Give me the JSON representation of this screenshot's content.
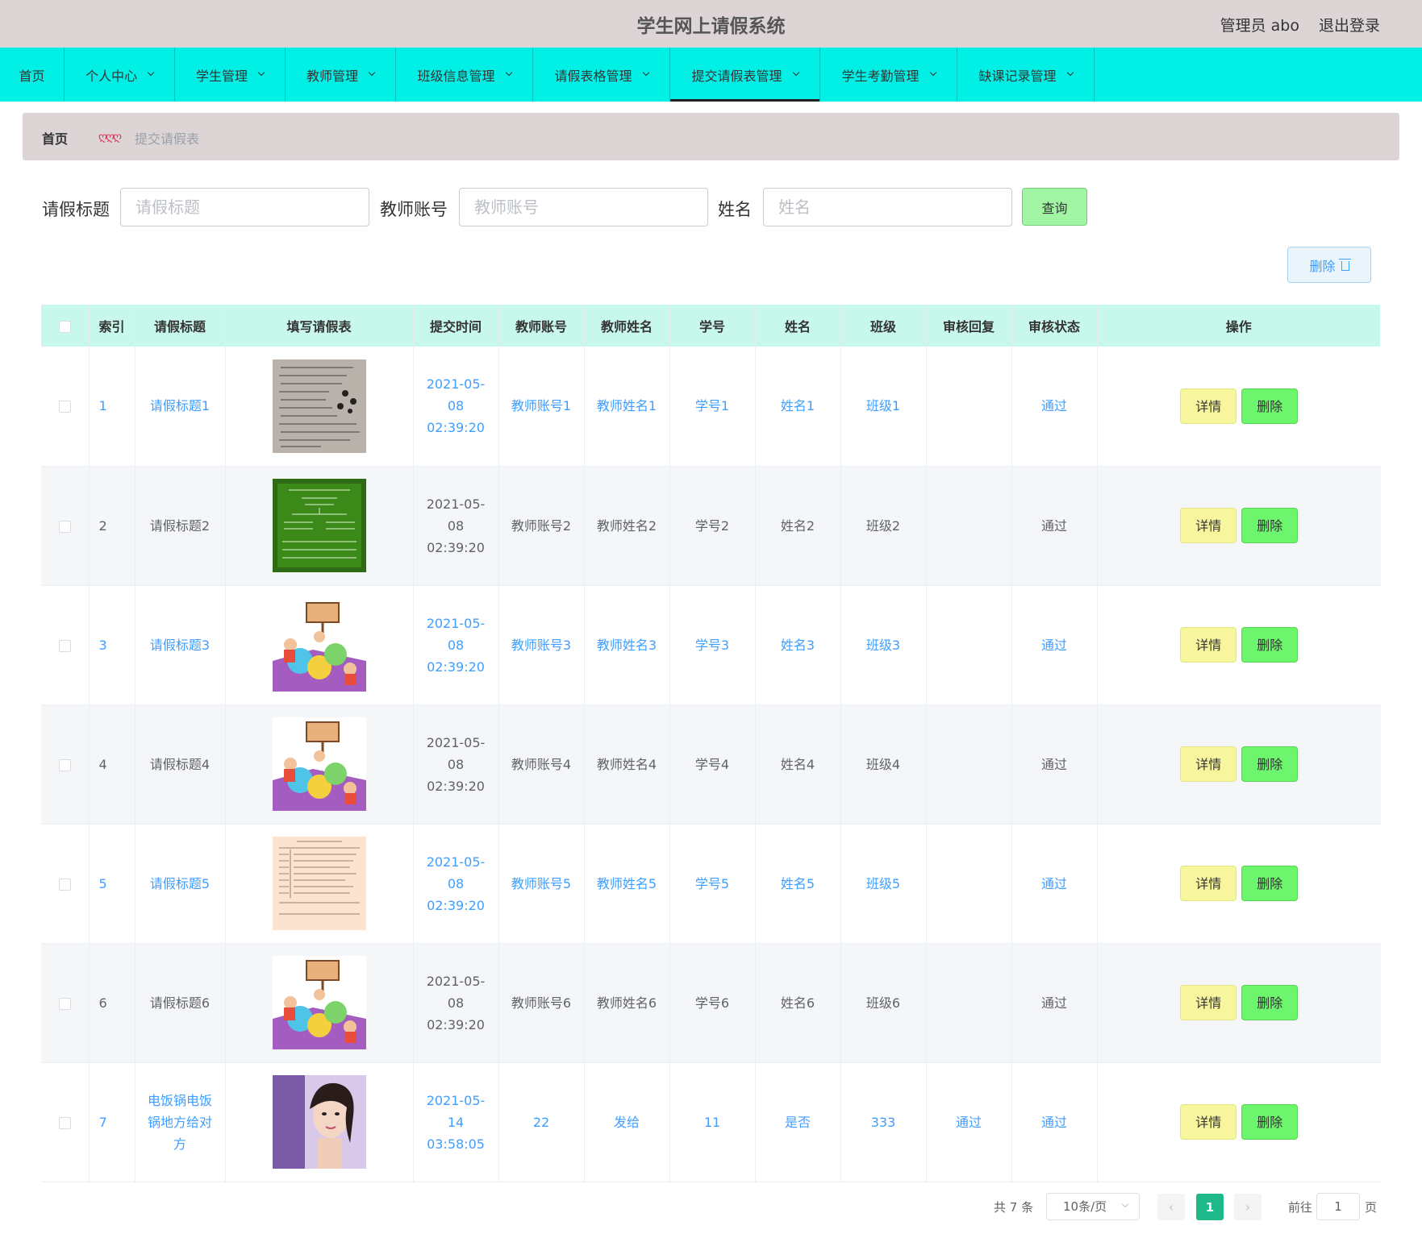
{
  "header": {
    "title": "学生网上请假系统",
    "user": "管理员 abo",
    "logout": "退出登录"
  },
  "nav": [
    {
      "label": "首页",
      "dropdown": false,
      "active": false
    },
    {
      "label": "个人中心",
      "dropdown": true,
      "active": false
    },
    {
      "label": "学生管理",
      "dropdown": true,
      "active": false
    },
    {
      "label": "教师管理",
      "dropdown": true,
      "active": false
    },
    {
      "label": "班级信息管理",
      "dropdown": true,
      "active": false
    },
    {
      "label": "请假表格管理",
      "dropdown": true,
      "active": false
    },
    {
      "label": "提交请假表管理",
      "dropdown": true,
      "active": true
    },
    {
      "label": "学生考勤管理",
      "dropdown": true,
      "active": false
    },
    {
      "label": "缺课记录管理",
      "dropdown": true,
      "active": false
    }
  ],
  "breadcrumb": {
    "home": "首页",
    "separator": "ღღღ",
    "current": "提交请假表"
  },
  "search": {
    "title_label": "请假标题",
    "title_placeholder": "请假标题",
    "teacher_label": "教师账号",
    "teacher_placeholder": "教师账号",
    "name_label": "姓名",
    "name_placeholder": "姓名",
    "query_button": "查询"
  },
  "bulk_delete_button": "删除",
  "table": {
    "columns": [
      "索引",
      "请假标题",
      "填写请假表",
      "提交时间",
      "教师账号",
      "教师姓名",
      "学号",
      "姓名",
      "班级",
      "审核回复",
      "审核状态",
      "操作"
    ],
    "detail_label": "详情",
    "delete_label": "删除",
    "rows": [
      {
        "index": "1",
        "title": "请假标题1",
        "image": "worksheet-scan",
        "time": "2021-05-08 02:39:20",
        "teacher_account": "教师账号1",
        "teacher_name": "教师姓名1",
        "student_id": "学号1",
        "name": "姓名1",
        "class": "班级1",
        "reply": "",
        "status": "通过"
      },
      {
        "index": "2",
        "title": "请假标题2",
        "image": "history-chalkboard",
        "time": "2021-05-08 02:39:20",
        "teacher_account": "教师账号2",
        "teacher_name": "教师姓名2",
        "student_id": "学号2",
        "name": "姓名2",
        "class": "班级2",
        "reply": "",
        "status": "通过"
      },
      {
        "index": "3",
        "title": "请假标题3",
        "image": "english-cartoon",
        "time": "2021-05-08 02:39:20",
        "teacher_account": "教师账号3",
        "teacher_name": "教师姓名3",
        "student_id": "学号3",
        "name": "姓名3",
        "class": "班级3",
        "reply": "",
        "status": "通过"
      },
      {
        "index": "4",
        "title": "请假标题4",
        "image": "english-cartoon",
        "time": "2021-05-08 02:39:20",
        "teacher_account": "教师账号4",
        "teacher_name": "教师姓名4",
        "student_id": "学号4",
        "name": "姓名4",
        "class": "班级4",
        "reply": "",
        "status": "通过"
      },
      {
        "index": "5",
        "title": "请假标题5",
        "image": "paper-form",
        "time": "2021-05-08 02:39:20",
        "teacher_account": "教师账号5",
        "teacher_name": "教师姓名5",
        "student_id": "学号5",
        "name": "姓名5",
        "class": "班级5",
        "reply": "",
        "status": "通过"
      },
      {
        "index": "6",
        "title": "请假标题6",
        "image": "english-cartoon",
        "time": "2021-05-08 02:39:20",
        "teacher_account": "教师账号6",
        "teacher_name": "教师姓名6",
        "student_id": "学号6",
        "name": "姓名6",
        "class": "班级6",
        "reply": "",
        "status": "通过"
      },
      {
        "index": "7",
        "title": "电饭锅电饭锅地方给对方",
        "image": "portrait-photo",
        "time": "2021-05-14 03:58:05",
        "teacher_account": "22",
        "teacher_name": "发给",
        "student_id": "11",
        "name": "是否",
        "class": "333",
        "reply": "通过",
        "status": "通过"
      }
    ]
  },
  "pagination": {
    "total": "共 7 条",
    "page_size": "10条/页",
    "prev_icon": "chevron-left-icon",
    "next_icon": "chevron-right-icon",
    "current_page": "1",
    "goto_label": "前往",
    "goto_value": "1",
    "page_unit": "页"
  },
  "colors": {
    "header_bg": "#ddd5d5",
    "nav_bg": "#00f0e6",
    "table_header_bg": "#c8f7ec",
    "link_blue": "#409eff",
    "detail_button": "#f7f59d",
    "delete_button": "#6cf56d",
    "query_button": "#a2f5a4",
    "active_page": "#1fb88a"
  }
}
